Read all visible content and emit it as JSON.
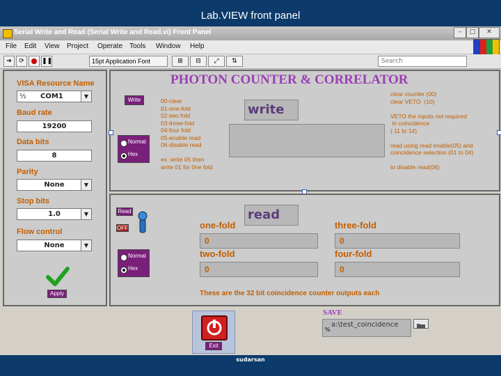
{
  "slide": {
    "title": "Lab.VIEW front panel",
    "footer": "sudarsan"
  },
  "window": {
    "title": "Serial Write and Read (Serial Write and Read.vi) Front Panel"
  },
  "menu": [
    "File",
    "Edit",
    "View",
    "Project",
    "Operate",
    "Tools",
    "Window",
    "Help"
  ],
  "toolbar": {
    "font": "15pt Application Font",
    "search_placeholder": "Search"
  },
  "serial": {
    "visa_label": "VISA Resource Name",
    "visa_prefix": "½",
    "visa_value": "COM1",
    "baud_label": "Baud rate",
    "baud_value": "19200",
    "databits_label": "Data bits",
    "databits_value": "8",
    "parity_label": "Parity",
    "parity_value": "None",
    "stopbits_label": "Stop bits",
    "stopbits_value": "1.0",
    "flow_label": "Flow control",
    "flow_value": "None",
    "apply_label": "Apply"
  },
  "write": {
    "title": "PHOTON COUNTER & CORRELATOR",
    "write_button": "Write",
    "normal_label": "Normal",
    "hex_label": "Hex",
    "header": "write",
    "commands": "00-clear\n01-one-fold\n02-two-fold\n03-three-fold\n04-four fold\n05-enable read\n06-disable read\n\nex: write 05 then\nwrite 01 for 0ne fold",
    "right_notes": "clear counter (00)\nclear VETO  (10)\n\nVETO the inputs not required\n in coincidence\n( 11 to 14)\n\nread using read enable(05) and\ncoincidence selection (01 to 04)\n\nto disable read(06)"
  },
  "read": {
    "read_button": "Read",
    "off_label": "OFF",
    "normal_label": "Normal",
    "hex_label": "Hex",
    "header": "read",
    "counters": [
      {
        "label": "one-fold",
        "value": "0"
      },
      {
        "label": "three-fold",
        "value": "0"
      },
      {
        "label": "two-fold",
        "value": "0"
      },
      {
        "label": "four-fold",
        "value": "0"
      }
    ],
    "caption": "These are the 32 bit coincidence counter outputs each"
  },
  "exit": {
    "label": "Exit"
  },
  "save": {
    "label": "SAVE",
    "path": "a:\\test_coincidence",
    "path_prefix": "%"
  }
}
